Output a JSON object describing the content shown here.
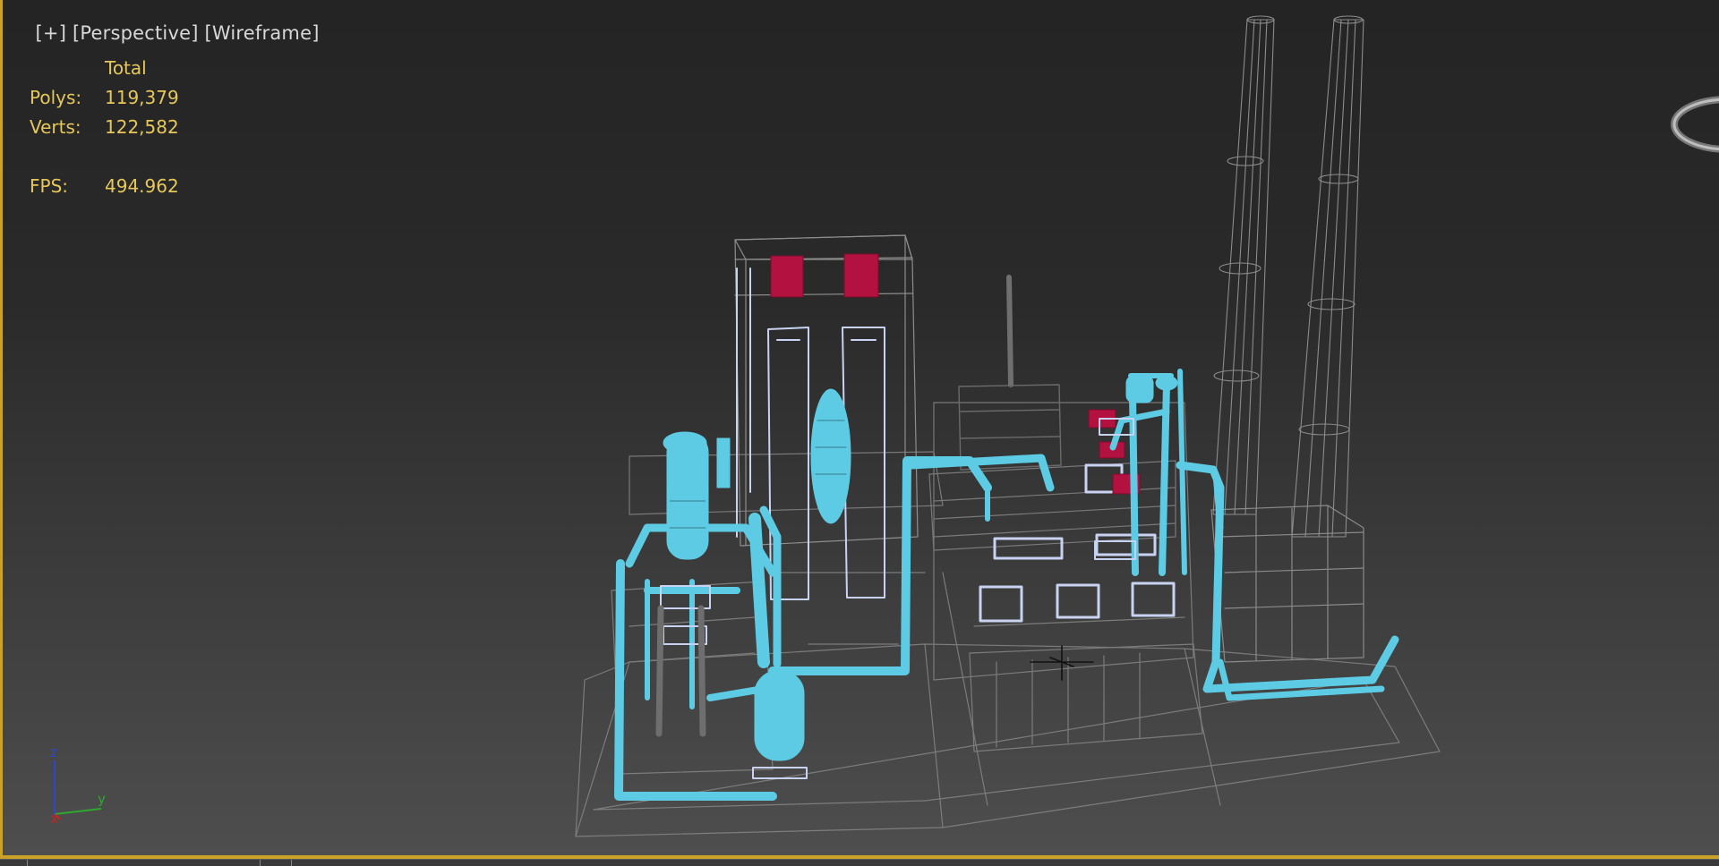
{
  "viewport": {
    "menu": {
      "plus": "[+]",
      "view": "[Perspective]",
      "shading": "[Wireframe]"
    },
    "stats": {
      "header": "Total",
      "polys_label": "Polys:",
      "polys_value": "119,379",
      "verts_label": "Verts:",
      "verts_value": "122,582",
      "fps_label": "FPS:",
      "fps_value": "494.962"
    },
    "axis": {
      "z": "z",
      "y": "y",
      "x": "x"
    }
  },
  "colors": {
    "active_border": "#c9a227",
    "stats_text": "#e6c85a",
    "selected_pipes": "#5ccbe3",
    "light_wire": "#c7d3f0",
    "red_objects": "#b3113f",
    "grey_wire": "#8a8a8a"
  },
  "icons": [
    "view-cube-icon",
    "axis-tripod-icon",
    "transform-gizmo-icon"
  ]
}
